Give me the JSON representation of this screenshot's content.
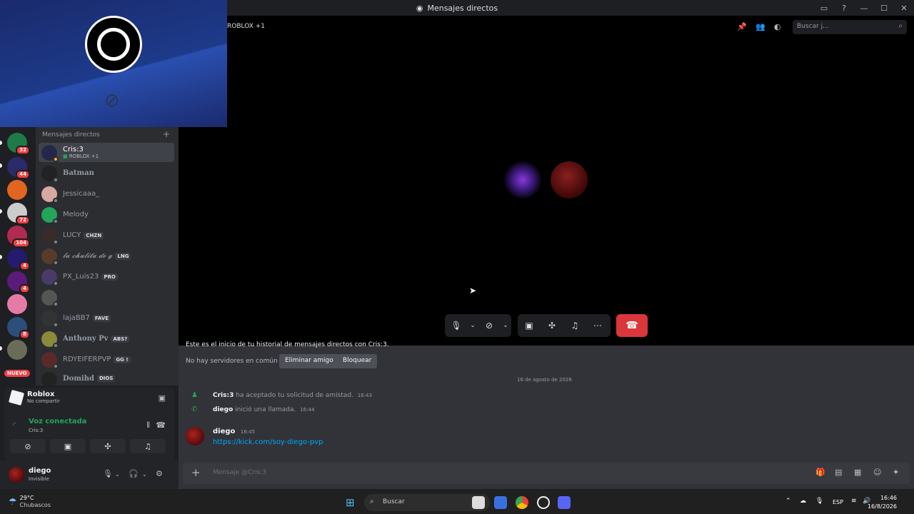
{
  "window": {
    "title": "Mensajes directos"
  },
  "topbar": {
    "group_name": "ROBLOX +1",
    "search_placeholder": "Buscar j..."
  },
  "servers": [
    {
      "badge": "32"
    },
    {
      "badge": "44"
    },
    {
      "badge": ""
    },
    {
      "badge": "72"
    },
    {
      "badge": "104"
    },
    {
      "badge": "4"
    },
    {
      "badge": "4"
    },
    {
      "badge": ""
    },
    {
      "badge": "8"
    },
    {
      "badge": ""
    }
  ],
  "nuevo_label": "NUEVO",
  "sidebar": {
    "header": "Mensajes directos",
    "add": "+",
    "dms": [
      {
        "name": "Cris:3",
        "sub": "ROBLOX +1",
        "tag": "",
        "active": true
      },
      {
        "name": "Batman",
        "tag": ""
      },
      {
        "name": "Jessicaaa_",
        "tag": ""
      },
      {
        "name": "Melody",
        "tag": ""
      },
      {
        "name": "LUCY",
        "tag": "CHZN"
      },
      {
        "name": "𝓵𝓪 𝓬𝓱𝓾𝓵𝓲𝓽𝓪 𝓭𝓮 𝓰",
        "tag": "LNG"
      },
      {
        "name": "PX_Luis23",
        "tag": "PRO"
      },
      {
        "name": "",
        "tag": ""
      },
      {
        "name": "lajaBB7",
        "tag": "FAVE"
      },
      {
        "name": "Anthony Pv",
        "tag": "ABS?"
      },
      {
        "name": "RDYEIFERPVP",
        "tag": "GG !"
      },
      {
        "name": "Domihd",
        "tag": "DIOS"
      }
    ]
  },
  "voice": {
    "activity": "Roblox",
    "activity_sub": "No compartir",
    "status": "Voz conectada",
    "channel": "Cris:3"
  },
  "user": {
    "name": "diego",
    "status": "Invisible"
  },
  "chat": {
    "history": "Este es el inicio de tu historial de mensajes directos con Cris:3.",
    "mutual": "No hay servidores en común",
    "dot": "•",
    "remove_friend": "Eliminar amigo",
    "block": "Bloquear",
    "date": "16 de agosto de 2026",
    "sys1_user": "Cris:3",
    "sys1_text": "ha aceptado tu solicitud de amistad.",
    "sys1_time": "16:43",
    "sys2_user": "diego",
    "sys2_text": "inició una llamada.",
    "sys2_time": "16:44",
    "msg_author": "diego",
    "msg_time": "16:45",
    "msg_link": "https://kick.com/soy-diego-pvp",
    "composer_placeholder": "Mensaje @Cris:3"
  },
  "taskbar": {
    "temp": "29°C",
    "weather": "Chubascos",
    "search": "Buscar",
    "lang": "ESP",
    "time": "16:46",
    "date": "16/8/2026"
  },
  "colors": {
    "accent_green": "#23a55a",
    "hangup_red": "#da373c",
    "link": "#00a8fc"
  }
}
